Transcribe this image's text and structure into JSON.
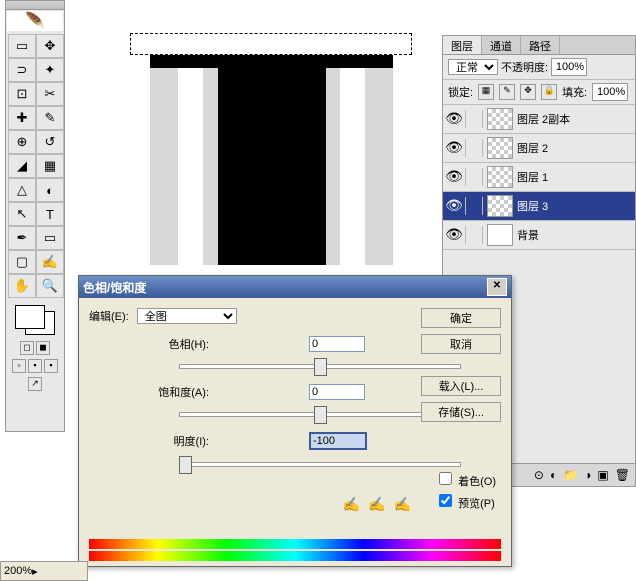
{
  "toolbox": {
    "tools": [
      "▭",
      "⬚",
      "↖",
      "✥",
      "⊡",
      "✂",
      "↗",
      "✎",
      "⌧",
      "◢",
      "✎",
      "▟",
      "⊕",
      "◐",
      "△",
      "⬚",
      "↖",
      "T",
      "✒",
      "▭",
      "▢",
      "⬚",
      "✋",
      "🔍"
    ]
  },
  "canvas": {},
  "layers": {
    "tabs": [
      "图层",
      "通道",
      "路径"
    ],
    "blend_mode": "正常",
    "opacity_label": "不透明度:",
    "opacity": "100%",
    "lock_label": "锁定:",
    "fill_label": "填充:",
    "fill": "100%",
    "items": [
      {
        "name": "图层 2副本",
        "selected": false
      },
      {
        "name": "图层 2",
        "selected": false
      },
      {
        "name": "图层 1",
        "selected": false
      },
      {
        "name": "图层 3",
        "selected": true
      },
      {
        "name": "背景",
        "selected": false
      }
    ]
  },
  "dialog": {
    "title": "色相/饱和度",
    "edit_label": "编辑(E):",
    "edit_value": "全图",
    "hue_label": "色相(H):",
    "hue_value": "0",
    "sat_label": "饱和度(A):",
    "sat_value": "0",
    "light_label": "明度(I):",
    "light_value": "-100",
    "ok": "确定",
    "cancel": "取消",
    "load": "载入(L)...",
    "save": "存储(S)...",
    "colorize": "着色(O)",
    "preview": "预览(P)"
  },
  "status": {
    "zoom": "200%"
  }
}
